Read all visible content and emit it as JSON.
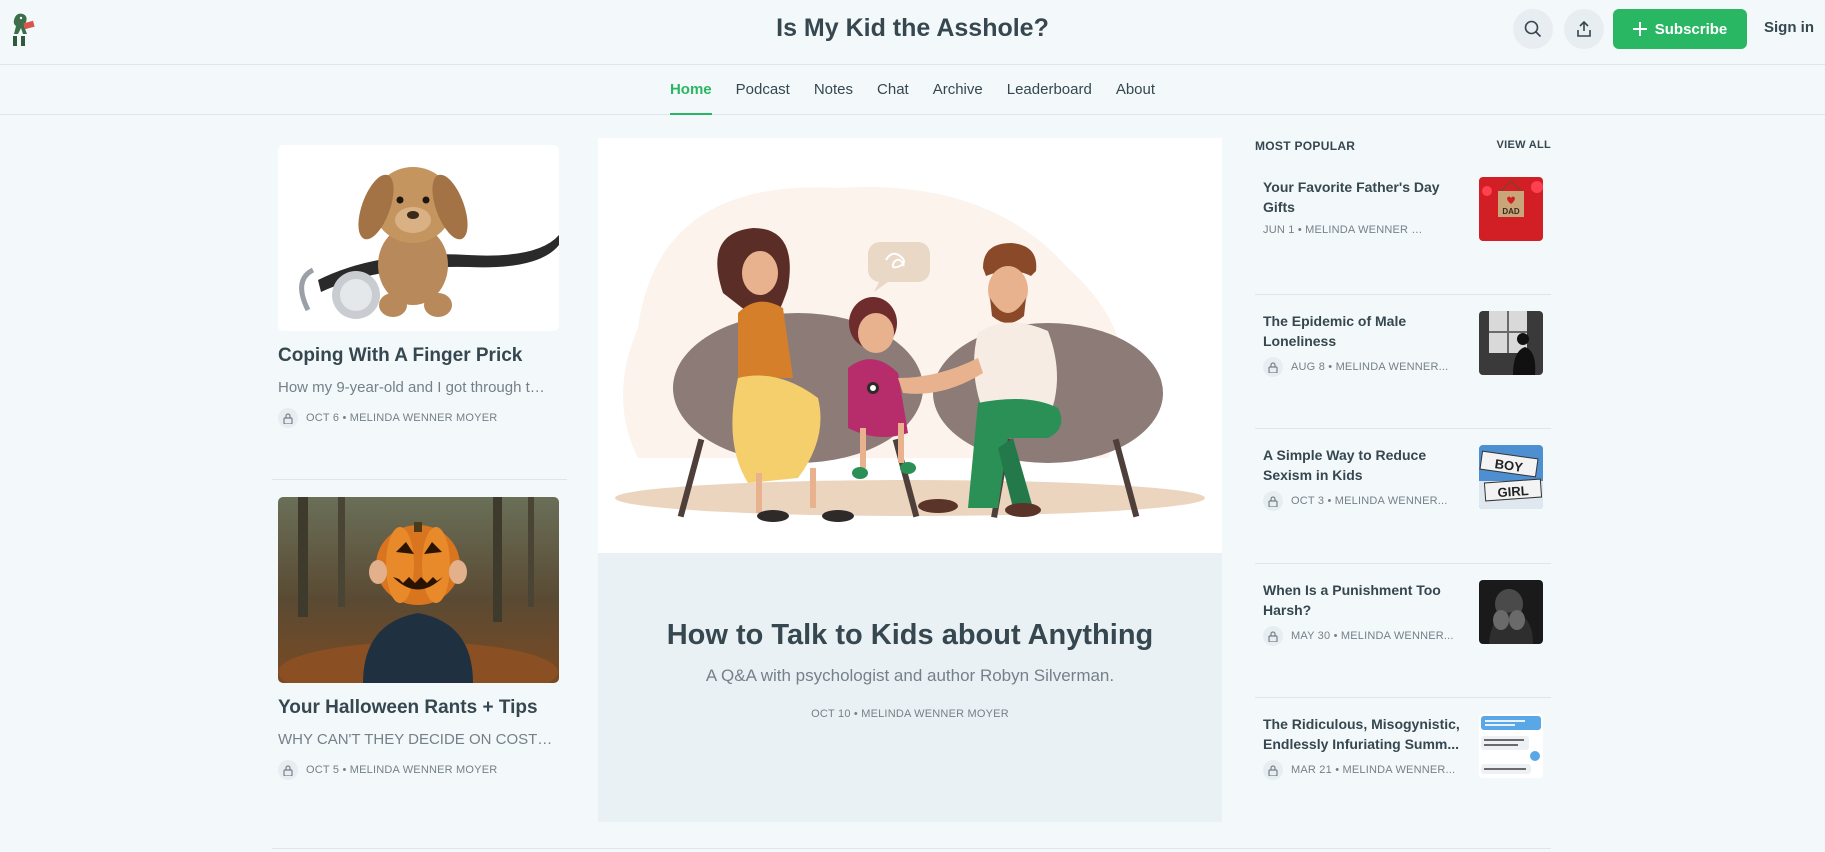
{
  "site": {
    "title": "Is My Kid the Asshole?"
  },
  "header": {
    "subscribe_label": "Subscribe",
    "signin_label": "Sign in"
  },
  "nav": {
    "items": [
      {
        "label": "Home",
        "active": true
      },
      {
        "label": "Podcast"
      },
      {
        "label": "Notes"
      },
      {
        "label": "Chat"
      },
      {
        "label": "Archive"
      },
      {
        "label": "Leaderboard"
      },
      {
        "label": "About"
      }
    ]
  },
  "left": {
    "posts": [
      {
        "title": "Coping With A Finger Prick",
        "subtitle": "How my 9-year-old and I got through the...",
        "meta": "OCT 6 • MELINDA WENNER MOYER"
      },
      {
        "title": "Your Halloween Rants + Tips",
        "subtitle": "WHY CAN'T THEY DECIDE ON COSTUM...",
        "meta": "OCT 5 • MELINDA WENNER MOYER"
      }
    ]
  },
  "hero": {
    "title": "How to Talk to Kids about Anything",
    "subtitle": "A Q&A with psychologist and author Robyn Silverman.",
    "meta": "OCT 10 • MELINDA WENNER MOYER"
  },
  "popular": {
    "heading": "MOST POPULAR",
    "view_all": "VIEW ALL",
    "items": [
      {
        "title": "Your Favorite Father's Day Gifts",
        "meta": "JUN 1 • MELINDA WENNER MOYER",
        "locked": false,
        "thumb_text": "DAD"
      },
      {
        "title": "The Epidemic of Male Loneliness",
        "meta": "AUG 8 • MELINDA WENNER...",
        "locked": true
      },
      {
        "title": "A Simple Way to Reduce Sexism in Kids",
        "meta": "OCT 3 • MELINDA WENNER...",
        "locked": true,
        "thumb_text_1": "BOY",
        "thumb_text_2": "GIRL"
      },
      {
        "title": "When Is a Punishment Too Harsh?",
        "meta": "MAY 30 • MELINDA WENNER...",
        "locked": true
      },
      {
        "title": "The Ridiculous, Misogynistic, Endlessly Infuriating Summ...",
        "meta": "MAR 21 • MELINDA WENNER...",
        "locked": true
      }
    ]
  }
}
